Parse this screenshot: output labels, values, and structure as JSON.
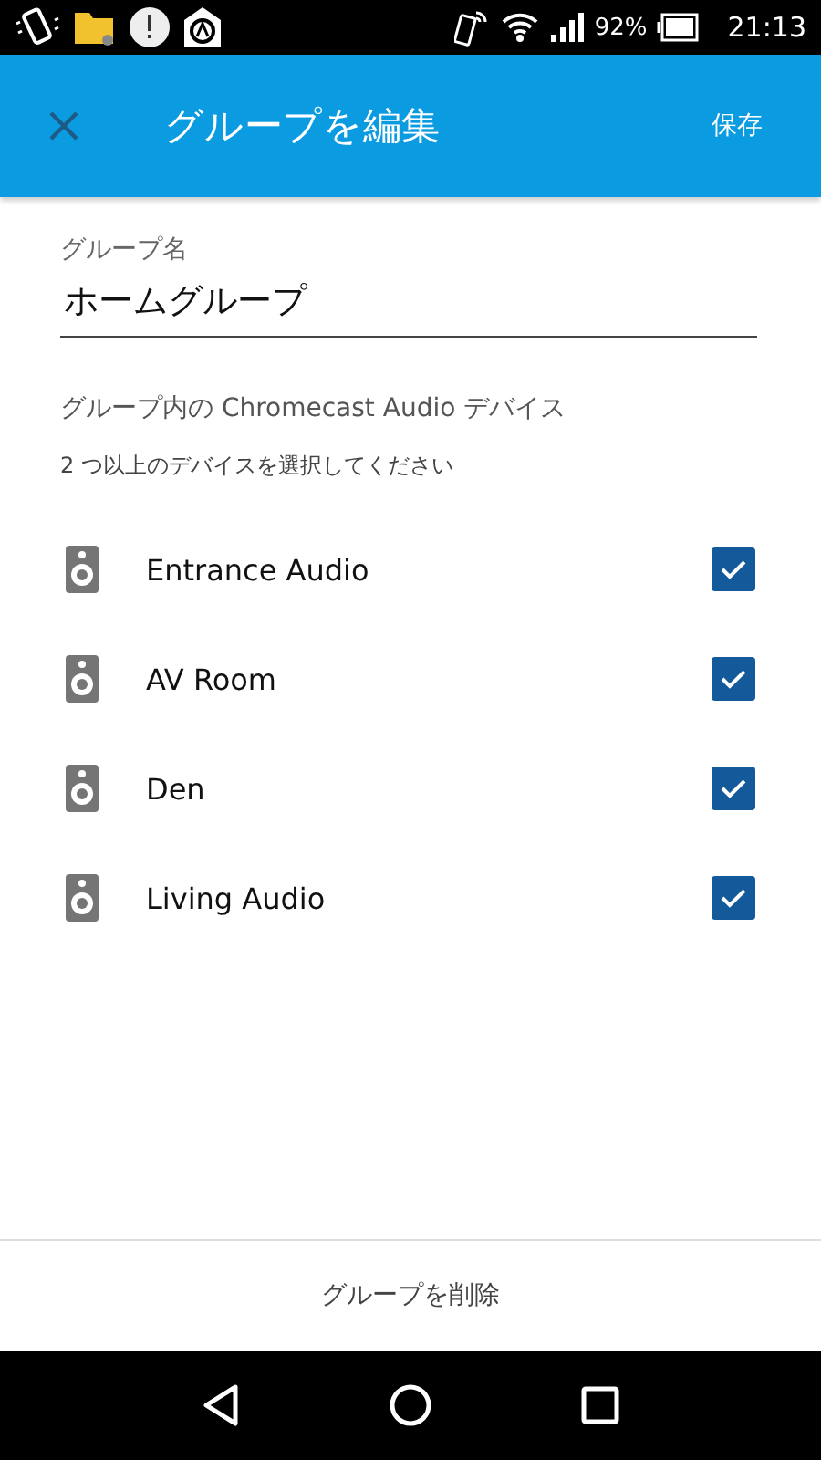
{
  "status_bar": {
    "battery": "92%",
    "time": "21:13"
  },
  "header": {
    "title": "グループを編集",
    "action": "保存"
  },
  "group_name": {
    "label": "グループ名",
    "value": "ホームグループ"
  },
  "devices_section": {
    "title": "グループ内の Chromecast Audio デバイス",
    "hint": "2 つ以上のデバイスを選択してください"
  },
  "devices": [
    {
      "name": "Entrance Audio",
      "checked": true
    },
    {
      "name": "AV Room",
      "checked": true
    },
    {
      "name": "Den",
      "checked": true
    },
    {
      "name": "Living Audio",
      "checked": true
    }
  ],
  "delete_button": "グループを削除"
}
